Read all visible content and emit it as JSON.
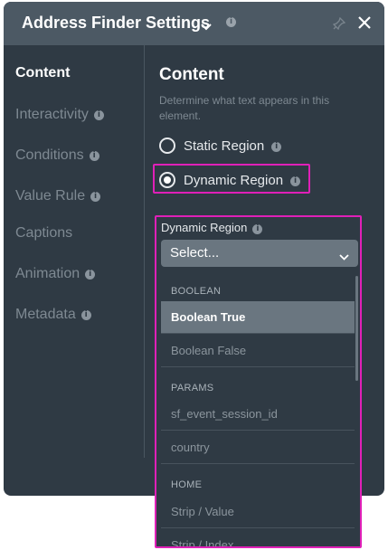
{
  "header": {
    "title": "Address Finder Settings",
    "info_badge": "i"
  },
  "sidebar": {
    "items": [
      {
        "label": "Content",
        "active": true
      },
      {
        "label": "Interactivity",
        "badge": "i"
      },
      {
        "label": "Conditions",
        "badge": "i"
      },
      {
        "label": "Value Rule",
        "badge": "i"
      },
      {
        "label": "Captions"
      },
      {
        "label": "Animation",
        "badge": "i"
      },
      {
        "label": "Metadata",
        "badge": "i"
      }
    ]
  },
  "content": {
    "title": "Content",
    "description": "Determine what text appears in this element.",
    "radios": [
      {
        "label": "Static Region",
        "checked": false,
        "badge": "i"
      },
      {
        "label": "Dynamic Region",
        "checked": true,
        "badge": "i"
      }
    ],
    "dynamic_region": {
      "label": "Dynamic Region",
      "badge": "i",
      "select_value": "Select...",
      "groups": [
        {
          "name": "BOOLEAN",
          "options": [
            "Boolean True",
            "Boolean False"
          ]
        },
        {
          "name": "PARAMS",
          "options": [
            "sf_event_session_id",
            "country"
          ]
        },
        {
          "name": "HOME",
          "options": [
            "Strip / Value",
            "Strip / Index"
          ]
        }
      ],
      "selected_option": "Boolean True"
    }
  },
  "colors": {
    "highlight": "#e020b8",
    "panel_bg": "#2f3a44",
    "header_bg": "#4c5964"
  }
}
